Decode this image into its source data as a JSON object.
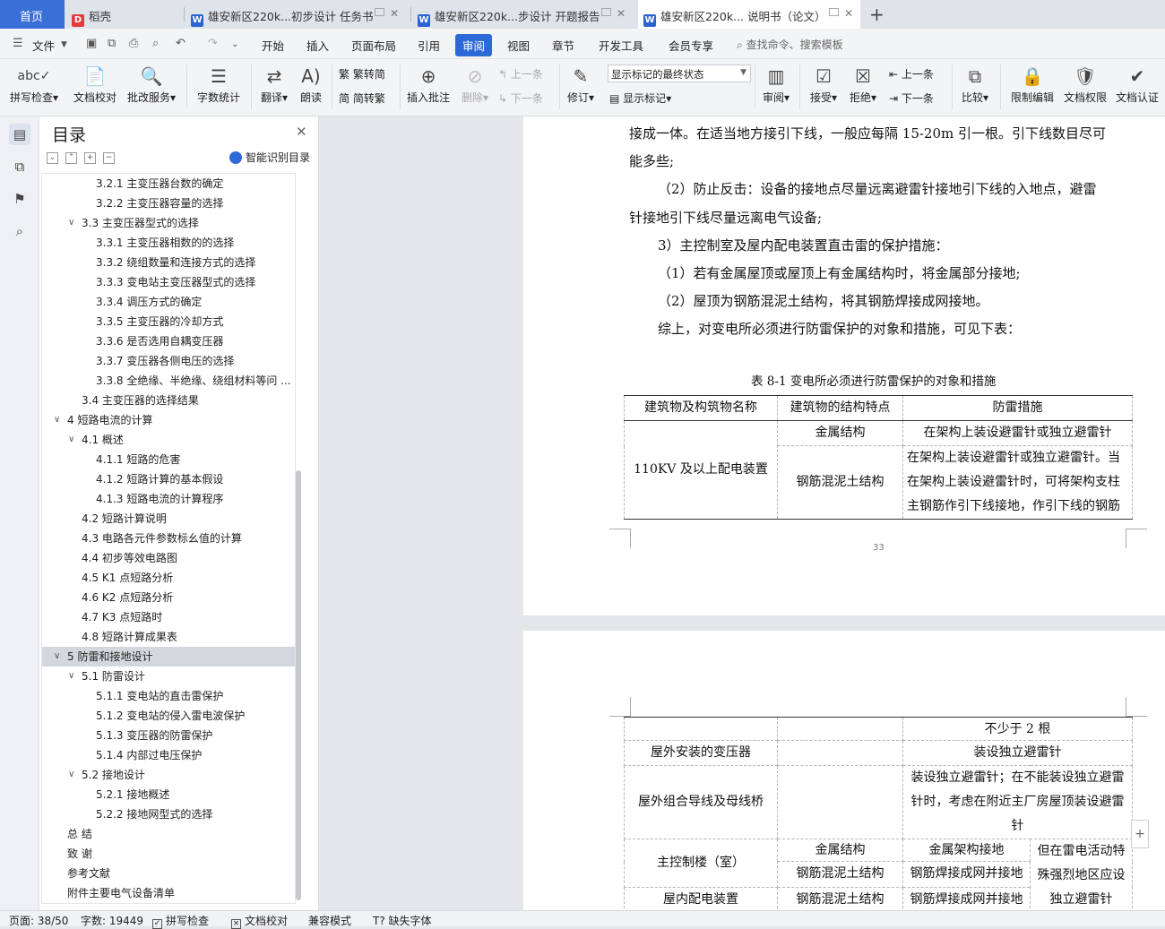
{
  "tabs": {
    "home": "首页",
    "items": [
      {
        "label": "稻壳",
        "icon": "docer-icon"
      },
      {
        "label": "雄安新区220k...初步设计 任务书",
        "icon": "word-icon"
      },
      {
        "label": "雄安新区220k...步设计 开题报告",
        "icon": "word-icon"
      },
      {
        "label": "雄安新区220k... 说明书（论文）",
        "icon": "word-icon"
      }
    ],
    "add": "+"
  },
  "menu": {
    "file": "文件",
    "items": [
      "开始",
      "插入",
      "页面布局",
      "引用",
      "审阅",
      "视图",
      "章节",
      "开发工具",
      "会员专享"
    ],
    "active": "审阅",
    "search": "查找命令、搜索模板"
  },
  "ribbon": {
    "spell": "拼写检查",
    "proof": "文档校对",
    "review_service": "批改服务",
    "word_count": "字数统计",
    "translate": "翻译",
    "read_aloud": "朗读",
    "trad_to_simp": "繁转简",
    "simp_to_trad": "简转繁",
    "insert_comment": "插入批注",
    "delete": "删除",
    "prev": "上一条",
    "next": "下一条",
    "track": "修订",
    "markup_state": "显示标记的最终状态",
    "show_markup": "显示标记",
    "review": "审阅",
    "accept": "接受",
    "reject": "拒绝",
    "prev2": "上一条",
    "next2": "下一条",
    "compare": "比较",
    "restrict": "限制编辑",
    "permission": "文档权限",
    "certify": "文档认证"
  },
  "toc": {
    "title": "目录",
    "smart": "智能识别目录",
    "items": [
      {
        "text": "3.2.1  主变压器台数的确定",
        "level": 3
      },
      {
        "text": "3.2.2  主变压器容量的选择",
        "level": 3
      },
      {
        "text": "3.3  主变压器型式的选择",
        "level": 2,
        "caret": true
      },
      {
        "text": "3.3.1  主变压器相数的的选择",
        "level": 3
      },
      {
        "text": "3.3.2 绕组数量和连接方式的选择",
        "level": 3
      },
      {
        "text": "3.3.3 变电站主变压器型式的选择",
        "level": 3
      },
      {
        "text": "3.3.4 调压方式的确定",
        "level": 3
      },
      {
        "text": "3.3.5 主变压器的冷却方式",
        "level": 3
      },
      {
        "text": "3.3.6 是否选用自耦变压器",
        "level": 3
      },
      {
        "text": "3.3.7 变压器各侧电压的选择",
        "level": 3
      },
      {
        "text": "3.3.8 全绝缘、半绝缘、绕组材料等问 ...",
        "level": 3
      },
      {
        "text": "3.4 主变压器的选择结果",
        "level": 2
      },
      {
        "text": "4  短路电流的计算",
        "level": 1,
        "caret": true
      },
      {
        "text": "4.1  概述",
        "level": 2,
        "caret": true
      },
      {
        "text": "4.1.1  短路的危害",
        "level": 3
      },
      {
        "text": "4.1.2  短路计算的基本假设",
        "level": 3
      },
      {
        "text": "4.1.3  短路电流的计算程序",
        "level": 3
      },
      {
        "text": "4.2  短路计算说明",
        "level": 2
      },
      {
        "text": "4.3  电路各元件参数标幺值的计算",
        "level": 2
      },
      {
        "text": "4.4  初步等效电路图",
        "level": 2
      },
      {
        "text": "4.5 K1 点短路分析",
        "level": 2
      },
      {
        "text": "4.6 K2 点短路分析",
        "level": 2
      },
      {
        "text": "4.7 K3 点短路时",
        "level": 2
      },
      {
        "text": "4.8  短路计算成果表",
        "level": 2
      },
      {
        "text": "5  防雷和接地设计",
        "level": 1,
        "caret": true,
        "selected": true
      },
      {
        "text": "5.1  防雷设计",
        "level": 2,
        "caret": true
      },
      {
        "text": "5.1.1 变电站的直击雷保护",
        "level": 3
      },
      {
        "text": "5.1.2  变电站的侵入雷电波保护",
        "level": 3
      },
      {
        "text": "5.1.3  变压器的防雷保护",
        "level": 3
      },
      {
        "text": "5.1.4 内部过电压保护",
        "level": 3
      },
      {
        "text": "5.2  接地设计",
        "level": 2,
        "caret": true
      },
      {
        "text": "5.2.1  接地概述",
        "level": 3
      },
      {
        "text": "5.2.2  接地网型式的选择",
        "level": 3
      },
      {
        "text": "总    结",
        "level": 1
      },
      {
        "text": "致    谢",
        "level": 1
      },
      {
        "text": "参考文献",
        "level": 1
      },
      {
        "text": "附件主要电气设备清单",
        "level": 1
      }
    ]
  },
  "doc": {
    "paras": [
      "接成一体。在适当地方接引下线，一般应每隔 15-20m 引一根。引下线数目尽可",
      "能多些;",
      "（2）防止反击：设备的接地点尽量远离避雷针接地引下线的入地点，避雷",
      "针接地引下线尽量远离电气设备;",
      "3）主控制室及屋内配电装置直击雷的保护措施：",
      "（1）若有金属屋顶或屋顶上有金属结构时，将金属部分接地;",
      "（2）屋顶为钢筋混泥土结构，将其钢筋焊接成网接地。",
      "综上，对变电所必须进行防雷保护的对象和措施，可见下表："
    ],
    "caption": "表 8-1  变电所必须进行防雷保护的对象和措施",
    "table1": {
      "headers": [
        "建筑物及构筑物名称",
        "建筑物的结构特点",
        "防雷措施"
      ],
      "row_name": "110KV 及以上配电装置",
      "r1_struct": "金属结构",
      "r1_measure": "在架构上装设避雷针或独立避雷针",
      "r2_struct": "钢筋混泥土结构",
      "r2_measure_lines": [
        "在架构上装设避雷针或独立避雷针。当",
        "在架构上装设避雷针时，可将架构支柱",
        "主钢筋作引下线接地，作引下线的钢筋"
      ]
    },
    "page_number": "33",
    "table2": {
      "r0_measure": "不少于 2 根",
      "r1_name": "屋外安装的变压器",
      "r1_measure": "装设独立避雷针",
      "r2_name": "屋外组合导线及母线桥",
      "r2_measure_lines": [
        "装设独立避雷针；在不能装设独立避雷",
        "针时，考虑在附近主厂房屋顶装设避雷",
        "针"
      ],
      "r3_name": "主控制楼（室）",
      "r3a_struct": "金属结构",
      "r3a_measure": "金属架构接地",
      "r3b_struct": "钢筋混泥土结构",
      "r3b_measure": "钢筋焊接成网并接地",
      "r3_note_lines": [
        "但在雷电活动特",
        "殊强烈地区应设",
        "独立避雷针"
      ],
      "r4_name": "屋内配电装置",
      "r4_struct": "钢筋混泥土结构",
      "r4_measure": "钢筋焊接成网并接地"
    }
  },
  "status": {
    "page": "页面: 38/50",
    "words": "字数: 19449",
    "spell": "拼写检查",
    "proof": "文档校对",
    "compat": "兼容模式",
    "missing_font": "缺失字体"
  }
}
